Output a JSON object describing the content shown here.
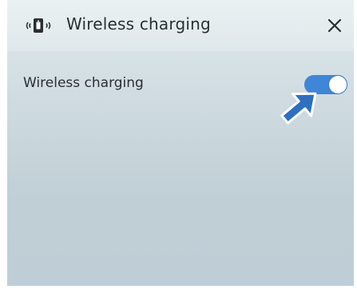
{
  "header": {
    "title": "Wireless charging",
    "icon": "wireless-charging-icon",
    "close_icon": "close-icon"
  },
  "settings": {
    "wireless_charging": {
      "label": "Wireless charging",
      "enabled": true
    }
  },
  "annotation": {
    "icon": "pointer-arrow-icon"
  },
  "colors": {
    "toggle_on": "#3f86d8",
    "arrow_fill": "#2f6fc0",
    "text": "#2b2f33"
  }
}
